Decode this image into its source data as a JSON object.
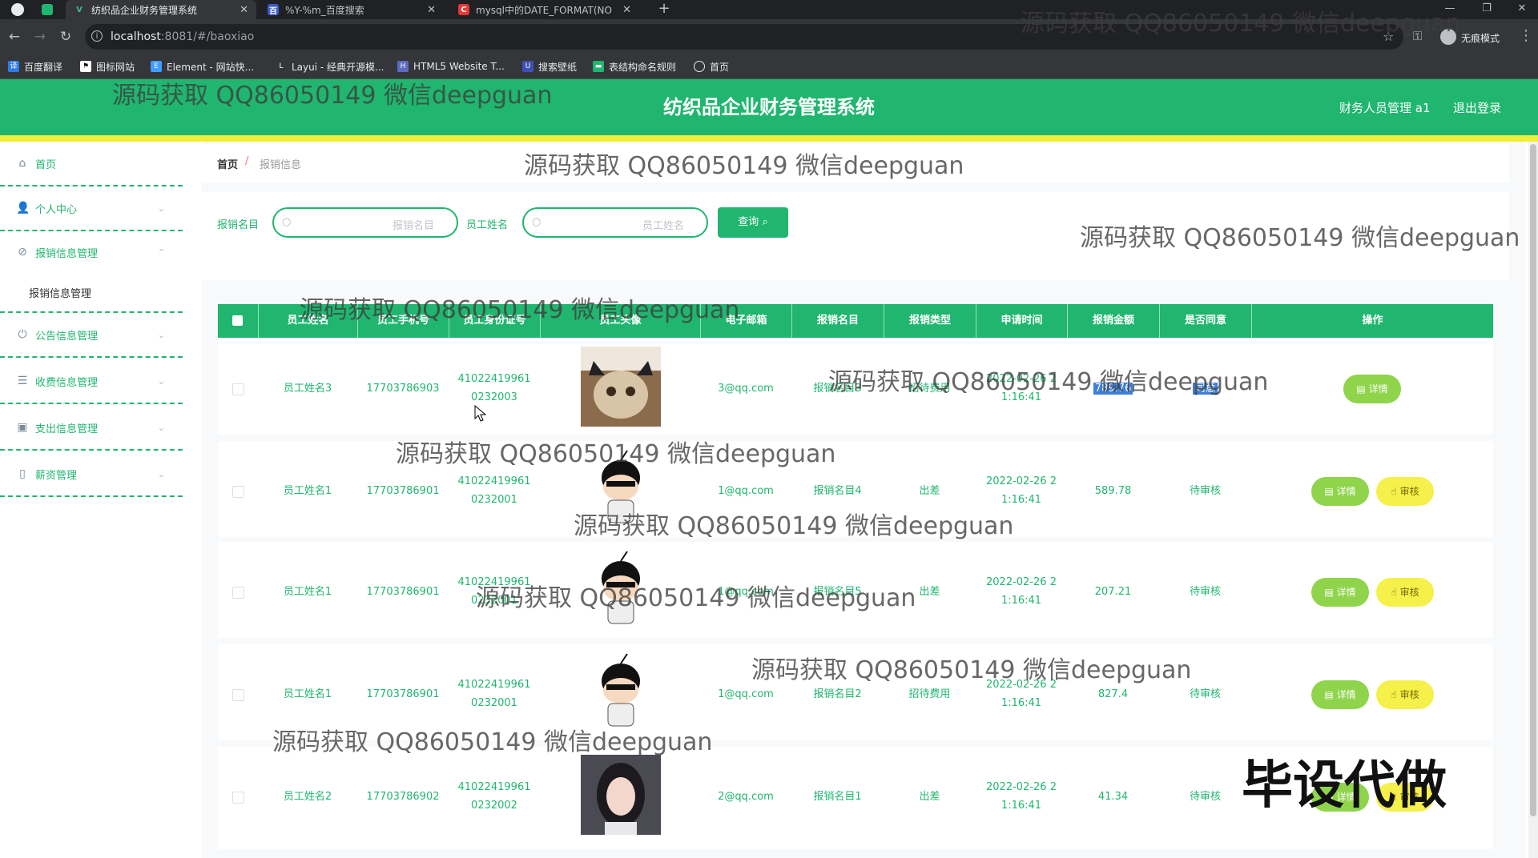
{
  "browser": {
    "tabs": [
      {
        "title": "纺织品企业财务管理系统",
        "active": true,
        "favicon": "V"
      },
      {
        "title": "%Y-%m_百度搜索",
        "active": false,
        "favicon": "百"
      },
      {
        "title": "mysql中的DATE_FORMAT(NO",
        "active": false,
        "favicon": "C"
      }
    ],
    "url_host": "localhost",
    "url_rest": ":8081/#/baoxiao",
    "incognito_label": "无痕模式",
    "bookmarks": [
      "百度翻译",
      "图标网站",
      "Element - 网站快...",
      "Layui - 经典开源模...",
      "HTML5 Website T...",
      "搜索壁纸",
      "表结构命名规则",
      "首页"
    ]
  },
  "app": {
    "title": "纺织品企业财务管理系统",
    "user_info": "财务人员管理 a1",
    "logout": "退出登录",
    "colors": {
      "primary": "#20b66f",
      "accent_strip": "#f1ee3a",
      "detail_btn": "#8fd44a",
      "audit_btn": "#f5f04a"
    }
  },
  "sidebar": {
    "items": [
      {
        "label": "首页",
        "icon": "home-icon",
        "arrow": ""
      },
      {
        "label": "个人中心",
        "icon": "user-icon",
        "arrow": "⌄"
      },
      {
        "label": "报销信息管理",
        "icon": "receipt-icon",
        "arrow": "⌃"
      },
      {
        "label": "公告信息管理",
        "icon": "power-icon",
        "arrow": "⌄"
      },
      {
        "label": "收费信息管理",
        "icon": "list-icon",
        "arrow": "⌄"
      },
      {
        "label": "支出信息管理",
        "icon": "briefcase-icon",
        "arrow": "⌄"
      },
      {
        "label": "薪资管理",
        "icon": "money-icon",
        "arrow": "⌄"
      }
    ],
    "sub_item": "报销信息管理"
  },
  "breadcrumb": {
    "home": "首页",
    "separator": "/",
    "current": "报销信息"
  },
  "search": {
    "field1_label": "报销名目",
    "field1_placeholder": "报销名目",
    "field2_label": "员工姓名",
    "field2_placeholder": "员工姓名",
    "query_button": "查询"
  },
  "table": {
    "headers": [
      "员工姓名",
      "员工手机号",
      "员工身份证号",
      "员工头像",
      "电子邮箱",
      "报销名目",
      "报销类型",
      "申请时间",
      "报销金额",
      "是否同意",
      "操作"
    ],
    "detail_label": "详情",
    "audit_label": "审核",
    "rows": [
      {
        "name": "员工姓名3",
        "phone": "17703786903",
        "id1": "41022419961",
        "id2": "0232003",
        "email": "3@qq.com",
        "item": "报销名目3",
        "type": "招待费用",
        "time1": "2022-02-26 2",
        "time2": "1:16:41",
        "amount": "789.76",
        "status": "同意",
        "avatar": "cat",
        "audit": false
      },
      {
        "name": "员工姓名1",
        "phone": "17703786901",
        "id1": "41022419961",
        "id2": "0232001",
        "email": "1@qq.com",
        "item": "报销名目4",
        "type": "出差",
        "time1": "2022-02-26 2",
        "time2": "1:16:41",
        "amount": "589.78",
        "status": "待审核",
        "avatar": "cartoon",
        "audit": true
      },
      {
        "name": "员工姓名1",
        "phone": "17703786901",
        "id1": "41022419961",
        "id2": "0232001",
        "email": "1@qq.com",
        "item": "报销名目5",
        "type": "出差",
        "time1": "2022-02-26 2",
        "time2": "1:16:41",
        "amount": "207.21",
        "status": "待审核",
        "avatar": "cartoon",
        "audit": true
      },
      {
        "name": "员工姓名1",
        "phone": "17703786901",
        "id1": "41022419961",
        "id2": "0232001",
        "email": "1@qq.com",
        "item": "报销名目2",
        "type": "招待费用",
        "time1": "2022-02-26 2",
        "time2": "1:16:41",
        "amount": "827.4",
        "status": "待审核",
        "avatar": "cartoon",
        "audit": true
      },
      {
        "name": "员工姓名2",
        "phone": "17703786902",
        "id1": "41022419961",
        "id2": "0232002",
        "email": "2@qq.com",
        "item": "报销名目1",
        "type": "出差",
        "time1": "2022-02-26 2",
        "time2": "1:16:41",
        "amount": "41.34",
        "status": "待审核",
        "avatar": "girl",
        "audit": true
      }
    ]
  },
  "watermark_text": "源码获取 QQ86050149 微信deepguan",
  "stamp_text": "毕设代做"
}
